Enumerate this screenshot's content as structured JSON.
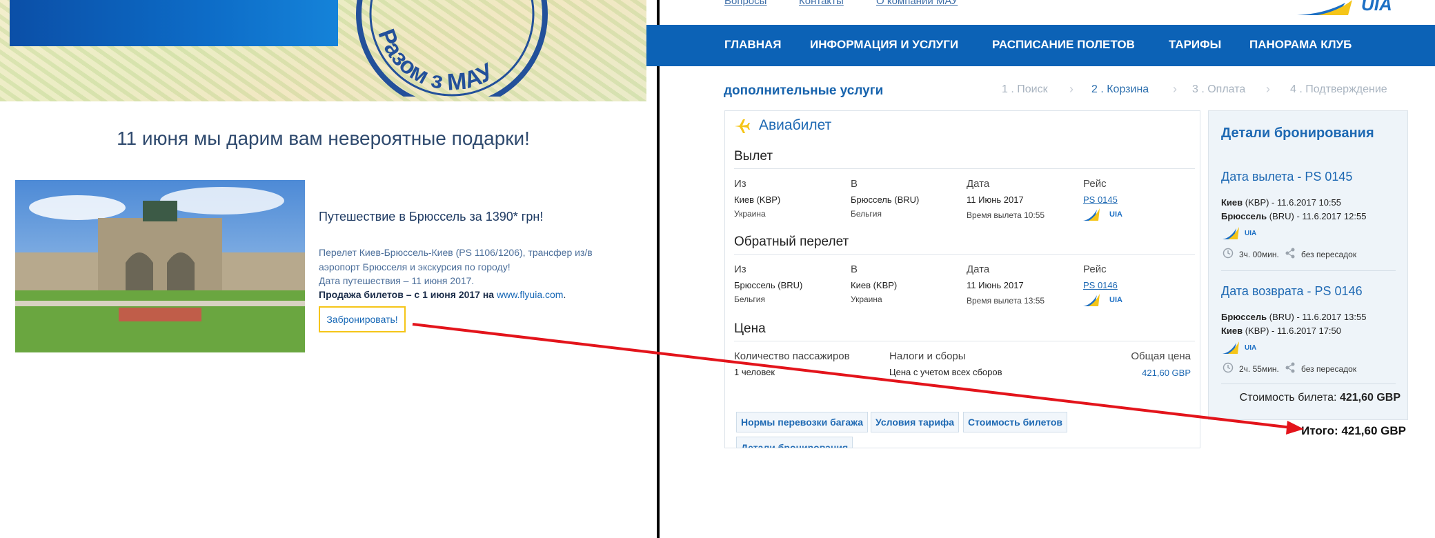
{
  "promo": {
    "stamp_text": "Разом з МАУ",
    "heading": "11 июня мы дарим вам невероятные подарки!",
    "title": "Путешествие в Брюссель за 1390* грн!",
    "desc_line1": "Перелет Киев-Брюссель-Киев (PS 1106/1206), трансфер из/в",
    "desc_line2": "аэропорт Брюсселя и экскурсия по городу!",
    "desc_line3": "Дата путешествия – 11 июня 2017.",
    "sale_prefix": "Продажа билетов – с 1 июня 2017 на ",
    "sale_link": "www.flyuia.com",
    "sale_suffix": ".",
    "book_button": "Забронировать!"
  },
  "top_links": [
    "Вопросы",
    "Контакты",
    "О компании МАУ"
  ],
  "logo_text": "UIA",
  "nav": [
    "ГЛАВНАЯ",
    "ИНФОРМАЦИЯ И УСЛУГИ",
    "РАСПИСАНИЕ ПОЛЕТОВ",
    "ТАРИФЫ",
    "ПАНОРАМА КЛУБ"
  ],
  "page_title": "дополнительные услуги",
  "steps": [
    "1 . Поиск",
    "2 . Корзина",
    "3 . Оплата",
    "4 . Подтверждение"
  ],
  "active_step_index": 1,
  "ticket": {
    "title": "Авиабилет",
    "outbound": {
      "section": "Вылет",
      "col_from": "Из",
      "col_to": "В",
      "col_date": "Дата",
      "col_flight": "Рейс",
      "from_city": "Киев (KBP)",
      "from_country": "Украина",
      "to_city": "Брюссель (BRU)",
      "to_country": "Бельгия",
      "date": "11 Июнь 2017",
      "time": "Время вылета 10:55",
      "flight": "PS 0145"
    },
    "return": {
      "section": "Обратный перелет",
      "col_from": "Из",
      "col_to": "В",
      "col_date": "Дата",
      "col_flight": "Рейс",
      "from_city": "Брюссель (BRU)",
      "from_country": "Бельгия",
      "to_city": "Киев (KBP)",
      "to_country": "Украина",
      "date": "11 Июнь 2017",
      "time": "Время вылета 13:55",
      "flight": "PS 0146"
    },
    "price": {
      "section": "Цена",
      "col_pax": "Количество пассажиров",
      "col_tax": "Налоги и сборы",
      "col_total": "Общая цена",
      "pax": "1 человек",
      "tax": "Цена с учетом всех сборов",
      "total": "421,60 GBP"
    },
    "tabs": [
      "Нормы перевозки багажа",
      "Условия тарифа",
      "Стоимость билетов",
      "Детали бронирования"
    ]
  },
  "details": {
    "title": "Детали бронирования",
    "depart_header": "Дата вылета - PS 0145",
    "depart_line1_city": "Киев",
    "depart_line1_rest": " (KBP) - 11.6.2017 10:55",
    "depart_line2_city": "Брюссель",
    "depart_line2_rest": " (BRU) - 11.6.2017 12:55",
    "depart_duration": "3ч. 00мин.",
    "depart_stops": "без пересадок",
    "return_header": "Дата возврата - PS 0146",
    "return_line1_city": "Брюссель",
    "return_line1_rest": " (BRU) - 11.6.2017 13:55",
    "return_line2_city": "Киев",
    "return_line2_rest": " (KBP) - 11.6.2017 17:50",
    "return_duration": "2ч. 55мин.",
    "return_stops": "без пересадок",
    "ticket_cost_label": "Стоимость билета: ",
    "ticket_cost_value": "421,60 GBP",
    "total_label": "Итого: ",
    "total_value": "421,60 GBP"
  },
  "colors": {
    "nav_bg": "#0c62b6",
    "accent_blue": "#1e69b3",
    "annotation_red": "#e3141b",
    "button_border_yellow": "#f5c518"
  }
}
